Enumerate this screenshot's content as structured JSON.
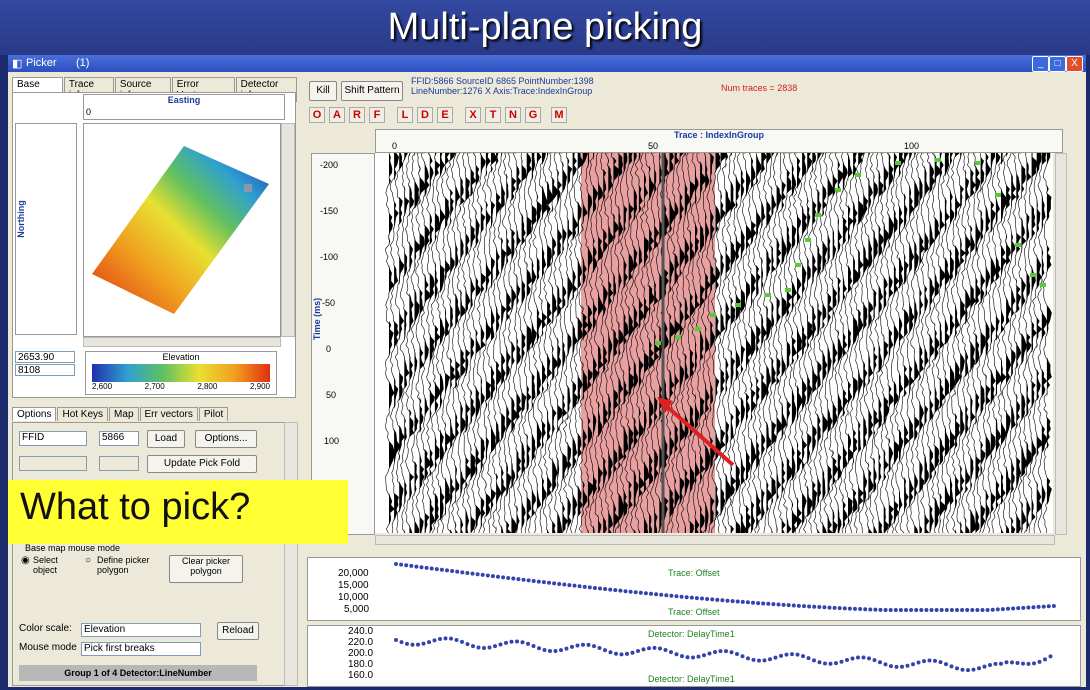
{
  "slide": {
    "title": "Multi-plane picking",
    "callout": "What to pick?"
  },
  "window": {
    "title": "Picker",
    "count": "(1)",
    "buttons": [
      "_",
      "□",
      "X"
    ]
  },
  "left_tabs": [
    "Base map",
    "Trace info",
    "Source info",
    "Error Vectors",
    "Detector info"
  ],
  "basemap": {
    "easting_label": "Easting",
    "easting_value": "0",
    "northing_label": "Northing",
    "value1": "2653.90",
    "value2": "8108",
    "elevation_label": "Elevation",
    "elevation_ticks": [
      "2,600",
      "2,700",
      "2,800",
      "2,900"
    ]
  },
  "options_tabs": [
    "Options",
    "Hot Keys",
    "Map",
    "Err vectors",
    "Pilot"
  ],
  "options": {
    "ffid_select": "FFID",
    "ffid_value": "5866",
    "load_button": "Load",
    "options_button": "Options...",
    "update_button": "Update Pick Fold",
    "mouse_mode_group": "Base map mouse mode",
    "radio_select": "Select object",
    "radio_define": "Define picker polygon",
    "clear_button": "Clear picker polygon",
    "color_scale_label": "Color scale:",
    "color_scale_value": "Elevation",
    "reload_button": "Reload",
    "mouse_mode_label": "Mouse mode",
    "mouse_mode_value": "Pick first breaks",
    "group_status": "Group 1 of 4 Detector:LineNumber"
  },
  "toolbar": {
    "kill_button": "Kill",
    "shift_button": "Shift Pattern",
    "info_line1": "FFID:5866 SourceID 6865 PointNumber:1398",
    "info_line2": "LineNumber:1276  X Axis:Trace:IndexInGroup",
    "num_traces": "Num traces = 2838",
    "letter_buttons": [
      "O",
      "A",
      "R",
      "F",
      "L",
      "D",
      "E",
      "X",
      "T",
      "N",
      "G",
      "M"
    ]
  },
  "seismic": {
    "x_axis_title": "Trace : IndexInGroup",
    "x_ticks": [
      "0",
      "50",
      "100"
    ],
    "y_axis_title": "Time (ms)",
    "y_ticks": [
      "-200",
      "-150",
      "-100",
      "-50",
      "0",
      "50",
      "100"
    ]
  },
  "offset_plot": {
    "title_top": "Trace: Offset",
    "title_bottom": "Trace: Offset",
    "y_ticks": [
      "20,000",
      "15,000",
      "10,000",
      "5,000"
    ]
  },
  "delay_plot": {
    "title_top": "Detector: DelayTime1",
    "title_bottom": "Detector: DelayTime1",
    "y_ticks": [
      "240.0",
      "220.0",
      "200.0",
      "180.0",
      "160.0"
    ]
  },
  "colors": {
    "slide_bg": "#2a3a88",
    "callout_bg": "#ffff33",
    "pick_green": "#55cc33",
    "highlight_pink": "#e8a0a0",
    "arrow_red": "#e02020",
    "dot_blue": "#3344aa"
  }
}
